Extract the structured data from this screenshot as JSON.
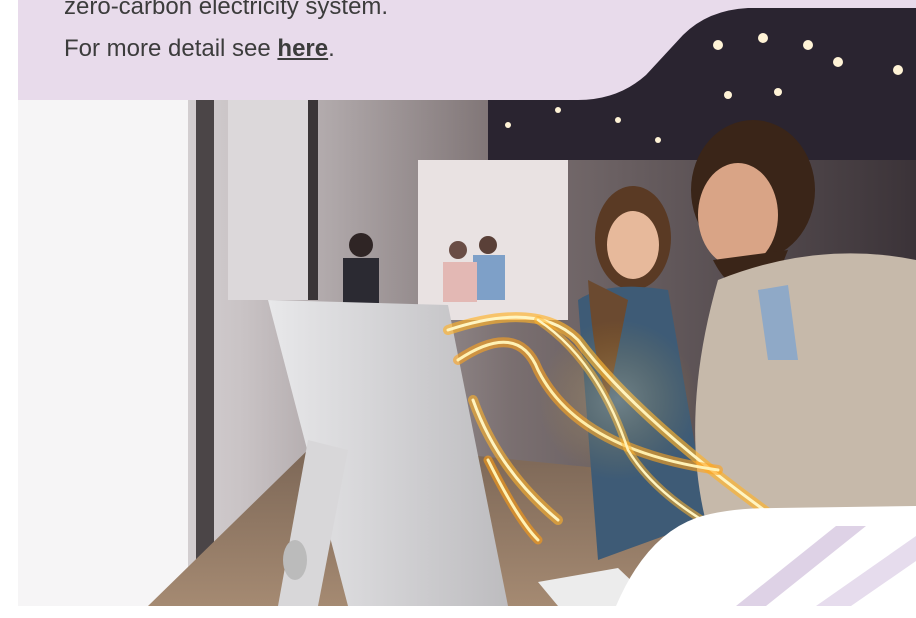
{
  "callout": {
    "line1": "zero-carbon electricity system.",
    "line2_prefix": "For more detail see ",
    "link_label": "here",
    "line2_suffix": "."
  },
  "colors": {
    "callout_bg": "#e8dbeb",
    "decor_stripe": "#d9cde4"
  },
  "image": {
    "subject": "people-at-computer-with-light-trails"
  }
}
